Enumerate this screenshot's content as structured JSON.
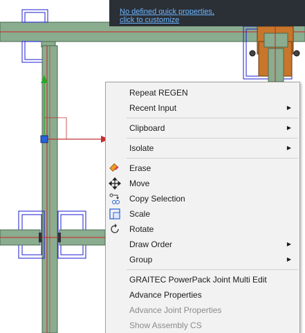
{
  "quick_properties": {
    "line1": "No defined quick properties,",
    "line2": "click to customize"
  },
  "context_menu": {
    "groups": [
      [
        {
          "label": "Repeat REGEN"
        },
        {
          "label": "Recent Input",
          "submenu": true
        }
      ],
      [
        {
          "label": "Clipboard",
          "submenu": true
        }
      ],
      [
        {
          "label": "Isolate",
          "submenu": true
        }
      ],
      [
        {
          "label": "Erase",
          "icon": "eraser-icon"
        },
        {
          "label": "Move",
          "icon": "move-icon"
        },
        {
          "label": "Copy Selection",
          "icon": "copy-selection-icon"
        },
        {
          "label": "Scale",
          "icon": "scale-icon"
        },
        {
          "label": "Rotate",
          "icon": "rotate-icon"
        },
        {
          "label": "Draw Order",
          "submenu": true
        },
        {
          "label": "Group",
          "submenu": true
        }
      ],
      [
        {
          "label": "GRAITEC PowerPack Joint Multi Edit"
        },
        {
          "label": "Advance Properties"
        },
        {
          "label": "Advance Joint Properties",
          "disabled": true
        },
        {
          "label": "Show Assembly CS",
          "disabled": true
        }
      ]
    ]
  },
  "colors": {
    "beam_fill": "#8aac8f",
    "beam_edge": "#4a6a50",
    "axis_line": "#d02020",
    "plate_outline": "#1a1ad0",
    "plate_fill": "#c8762c",
    "tooltip_bg": "#2b2f36",
    "link": "#6bb6ff",
    "menu_bg": "#f2f2f2"
  }
}
